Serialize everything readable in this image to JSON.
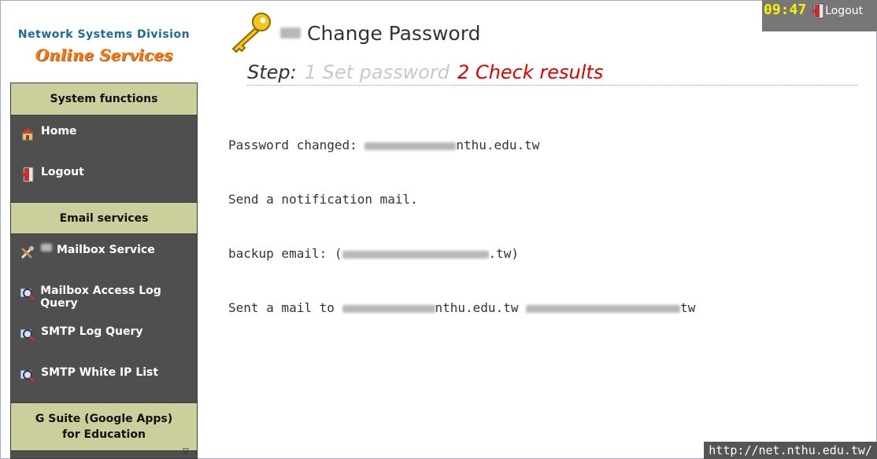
{
  "logo": {
    "line1": "Network Systems Division",
    "line2": "Online Services"
  },
  "topbar": {
    "time": "09:47",
    "logout_label": "Logout"
  },
  "sidebar": {
    "sections": [
      {
        "title": "System functions",
        "items": [
          {
            "label": "Home",
            "icon": "home-icon"
          },
          {
            "label": "Logout",
            "icon": "logout-icon"
          }
        ]
      },
      {
        "title": "Email services",
        "items": [
          {
            "label": "Mailbox Service",
            "icon": "tools-icon"
          },
          {
            "label": "Mailbox Access Log Query",
            "icon": "magnifier-icon"
          },
          {
            "label": "SMTP Log Query",
            "icon": "magnifier-icon"
          },
          {
            "label": "SMTP White IP List",
            "icon": "magnifier-icon"
          }
        ]
      },
      {
        "title": "G Suite (Google Apps) for Education"
      }
    ]
  },
  "main": {
    "title": "Change Password",
    "steps": {
      "label": "Step:",
      "step1": "1 Set password",
      "step2": "2 Check results"
    },
    "result": {
      "line1_prefix": "Password changed: ",
      "line1_suffix": "nthu.edu.tw",
      "line2": "Send a notification mail.",
      "line3_prefix": "backup email: (",
      "line3_suffix": ".tw)",
      "line4_prefix": "Sent a mail to ",
      "line4_mid": "nthu.edu.tw ",
      "line4_suffix": "tw"
    }
  },
  "footer": {
    "url": "http://net.nthu.edu.tw/"
  },
  "colors": {
    "accent_red": "#e00000",
    "header_khaki": "#cbcf9b",
    "sidebar_bg": "#4f4f4f",
    "clock_yellow": "#f4f400"
  }
}
